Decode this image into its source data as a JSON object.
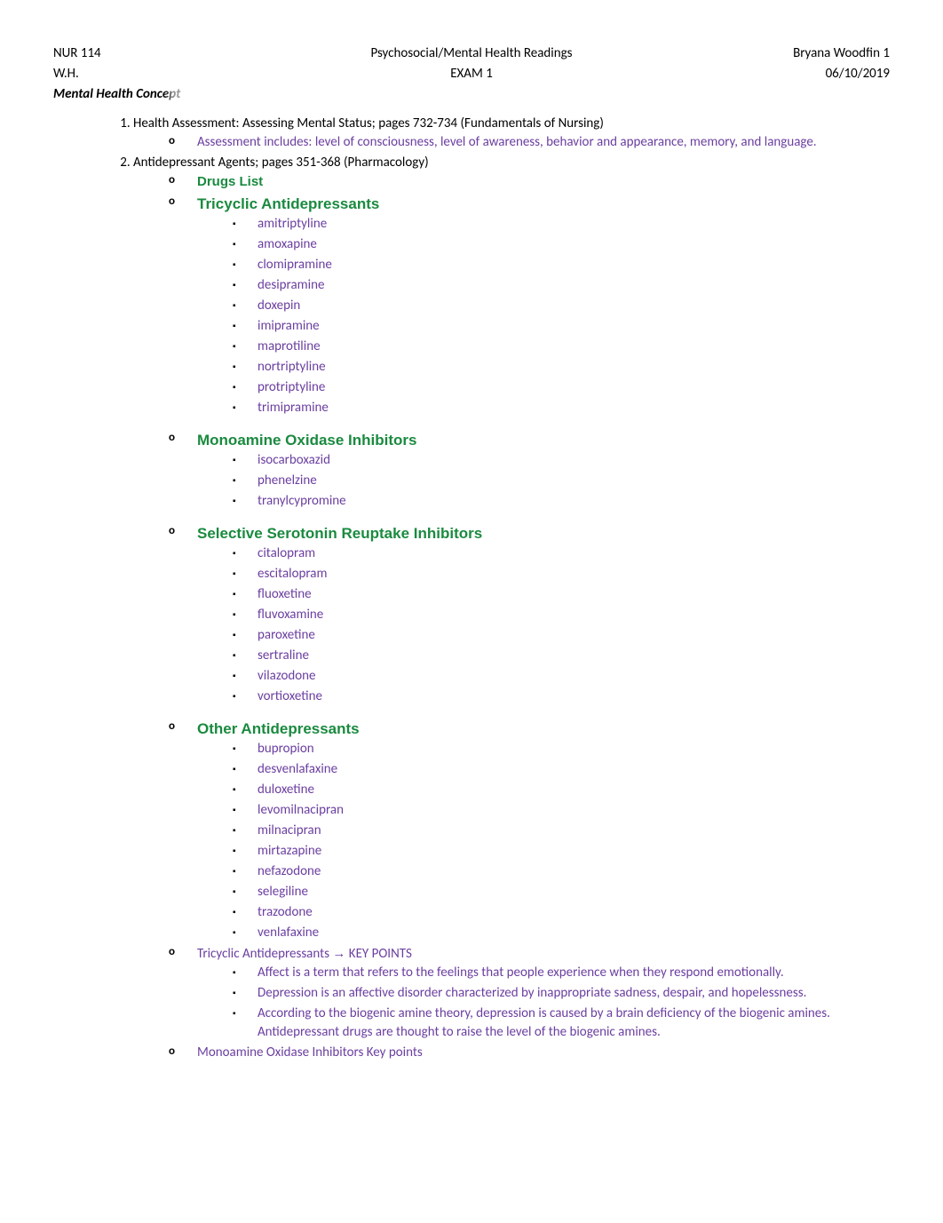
{
  "header": {
    "row1_left": "NUR 114",
    "row1_center": "Psychosocial/Mental Health Readings",
    "row1_right": "Bryana Woodfin 1",
    "row2_left": "W.H.",
    "row2_center": "EXAM 1",
    "row2_right": "06/10/2019",
    "subtitle": "Mental Health Concept"
  },
  "item1": {
    "text": "Health Assessment: Assessing Mental Status; pages 732-734 (Fundamentals of Nursing)",
    "sub": "Assessment includes: level of consciousness, level of awareness, behavior and appearance, memory, and language."
  },
  "item2": {
    "text": "Antidepressant Agents; pages 351-368 (Pharmacology)",
    "drugs_list_label": "Drugs List",
    "categories": {
      "tricyclic": {
        "title": "Tricyclic Antidepressants",
        "drugs": [
          "amitriptyline",
          "amoxapine",
          "clomipramine",
          "desipramine",
          "doxepin",
          " imipramine",
          "maprotiline",
          "nortriptyline",
          "protriptyline",
          "trimipramine"
        ]
      },
      "maoi": {
        "title": "Monoamine Oxidase Inhibitors",
        "drugs": [
          "isocarboxazid",
          " phenelzine",
          "tranylcypromine"
        ]
      },
      "ssri": {
        "title": "Selective Serotonin Reuptake Inhibitors",
        "drugs": [
          "citalopram",
          "escitalopram",
          " fluoxetine",
          "fluvoxamine",
          "paroxetine",
          "sertraline",
          "vilazodone",
          "vortioxetine"
        ]
      },
      "other": {
        "title": "Other Antidepressants",
        "drugs": [
          "bupropion",
          "desvenlafaxine",
          "duloxetine",
          "levomilnacipran",
          "milnacipran",
          "mirtazapine",
          "nefazodone",
          "selegiline",
          "trazodone",
          "venlafaxine"
        ]
      }
    },
    "keypoints_tricyclic": {
      "title_a": "Tricyclic Antidepressants ",
      "arrow": "→",
      "title_b": " KEY POINTS",
      "points": [
        " Affect is a term that refers to the feelings that people experience when they respond emotionally.",
        "Depression is an affective disorder characterized by inappropriate sadness, despair, and hopelessness.",
        "According to the biogenic amine theory, depression is caused by a brain deficiency of the biogenic amines. Antidepressant drugs are thought to raise the level of the biogenic amines."
      ]
    },
    "keypoints_maoi": {
      "title": "Monoamine Oxidase Inhibitors Key points"
    }
  }
}
